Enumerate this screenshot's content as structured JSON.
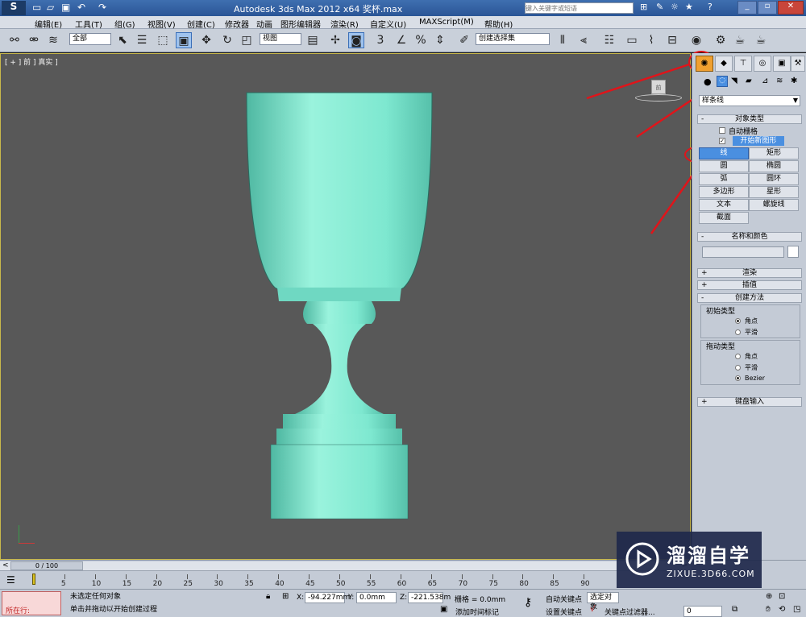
{
  "title": "Autodesk 3ds Max  2012 x64    奖杯.max",
  "search_placeholder": "键入关键字或短语",
  "menu": [
    "编辑(E)",
    "工具(T)",
    "组(G)",
    "视图(V)",
    "创建(C)",
    "修改器",
    "动画",
    "图形编辑器",
    "渲染(R)",
    "自定义(U)",
    "MAXScript(M)",
    "帮助(H)"
  ],
  "toolbar": {
    "selection_filter": "全部",
    "reference_coord": "视图",
    "named_selection": "创建选择集"
  },
  "viewport": {
    "label": "[ + ] 前 ] 真实 ]"
  },
  "command_panel": {
    "category_dropdown": "样条线",
    "object_type": {
      "title": "对象类型",
      "auto_grid": "自动栅格",
      "start_new_shape": "开始新图形",
      "start_new_shape_checked": true,
      "buttons": [
        "线",
        "矩形",
        "圆",
        "椭圆",
        "弧",
        "圆环",
        "多边形",
        "星形",
        "文本",
        "螺旋线",
        "截面"
      ],
      "active_button": "线"
    },
    "name_color": {
      "title": "名称和颜色"
    },
    "rendering": {
      "title": "渲染"
    },
    "interpolation": {
      "title": "插值"
    },
    "creation_method": {
      "title": "创建方法",
      "initial_type": {
        "label": "初始类型",
        "options": [
          "角点",
          "平滑"
        ],
        "selected": "角点"
      },
      "drag_type": {
        "label": "拖动类型",
        "options": [
          "角点",
          "平滑",
          "Bezier"
        ],
        "selected": "Bezier"
      }
    },
    "keyboard_entry": {
      "title": "键盘输入"
    }
  },
  "timeline": {
    "frame_counter": "0 / 100",
    "ticks": [
      "5",
      "10",
      "15",
      "20",
      "25",
      "30",
      "35",
      "40",
      "45",
      "50",
      "55",
      "60",
      "65",
      "70",
      "75",
      "80",
      "85",
      "90"
    ]
  },
  "status": {
    "running": "所在行:",
    "selection_msg": "未选定任何对象",
    "prompt": "单击并拖动以开始创建过程",
    "x_label": "X:",
    "x_value": "-94.227mm",
    "y_label": "Y:",
    "y_value": "0.0mm",
    "z_label": "Z:",
    "z_value": "-221.538m",
    "grid": "栅格 = 0.0mm",
    "add_time_tag": "添加时间标记",
    "auto_key": "自动关键点",
    "set_key": "设置关键点",
    "selected_obj": "选定对象",
    "key_filters": "关键点过滤器...",
    "frame_field": "0"
  },
  "watermark": {
    "brand": "溜溜自学",
    "url": "ZIXUE.3D66.COM"
  },
  "colors": {
    "viewport_bg": "#585858",
    "model": "#7ee8d0",
    "highlight_blue": "#4a8fe0",
    "annotation_red": "#e0141a"
  }
}
